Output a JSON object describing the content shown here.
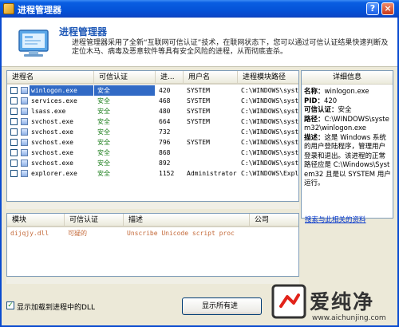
{
  "window": {
    "title": "进程管理器",
    "help_label": "?",
    "close_label": "×"
  },
  "header": {
    "title": "进程管理器",
    "description": "进程管理器采用了全新“互联网可信认证”技术，在联网状态下，您可以通过可信认证结果快速判断及定位木马、病毒及恶意软件等具有安全风险的进程，从而彻底查杀。"
  },
  "process_table": {
    "columns": [
      "进程名",
      "可信认证",
      "进...",
      "用户名",
      "进程模块路径"
    ],
    "rows": [
      {
        "name": "winlogon.exe",
        "trust": "安全",
        "pid": "420",
        "user": "SYSTEM",
        "path": "C:\\WINDOWS\\syst",
        "selected": true
      },
      {
        "name": "services.exe",
        "trust": "安全",
        "pid": "468",
        "user": "SYSTEM",
        "path": "C:\\WINDOWS\\syst",
        "selected": false
      },
      {
        "name": "lsass.exe",
        "trust": "安全",
        "pid": "480",
        "user": "SYSTEM",
        "path": "C:\\WINDOWS\\syst",
        "selected": false
      },
      {
        "name": "svchost.exe",
        "trust": "安全",
        "pid": "664",
        "user": "SYSTEM",
        "path": "C:\\WINDOWS\\syst",
        "selected": false
      },
      {
        "name": "svchost.exe",
        "trust": "安全",
        "pid": "732",
        "user": "",
        "path": "C:\\WINDOWS\\syst",
        "selected": false
      },
      {
        "name": "svchost.exe",
        "trust": "安全",
        "pid": "796",
        "user": "SYSTEM",
        "path": "C:\\WINDOWS\\syst",
        "selected": false
      },
      {
        "name": "svchost.exe",
        "trust": "安全",
        "pid": "868",
        "user": "",
        "path": "C:\\WINDOWS\\syst",
        "selected": false
      },
      {
        "name": "svchost.exe",
        "trust": "安全",
        "pid": "892",
        "user": "",
        "path": "C:\\WINDOWS\\syst",
        "selected": false
      },
      {
        "name": "explorer.exe",
        "trust": "安全",
        "pid": "1152",
        "user": "Administrator",
        "path": "C:\\WINDOWS\\Explo",
        "selected": false
      }
    ]
  },
  "details": {
    "heading": "详细信息",
    "name_label": "名称：",
    "name_value": "winlogon.exe",
    "pid_label": "PID：",
    "pid_value": "420",
    "trust_label": "可信认证：",
    "trust_value": "安全",
    "path_label": "路径：",
    "path_value": "C:\\WINDOWS\\system32\\winlogon.exe",
    "desc_label": "描述：",
    "desc_value": "这是 Windows 系统的用户登陆程序，管理用户登录和退出。该进程的正常路径应是 C:\\Windows\\System32 且是以 SYSTEM 用户运行。",
    "link": "搜索与此相关的资料"
  },
  "dll_table": {
    "columns": [
      "模块",
      "可信认证",
      "描述",
      "公司"
    ],
    "rows": [
      {
        "module": "dijqjy.dll",
        "trust": "可疑的",
        "description": "Unscribe Unicode script proc",
        "company": ""
      }
    ]
  },
  "bottom": {
    "checkbox_label": "显示加载到进程中的DLL",
    "checkbox_checked": true,
    "show_all_button": "显示所有进"
  },
  "watermark": {
    "text": "爱纯净",
    "url": "www.aichunjing.com"
  }
}
